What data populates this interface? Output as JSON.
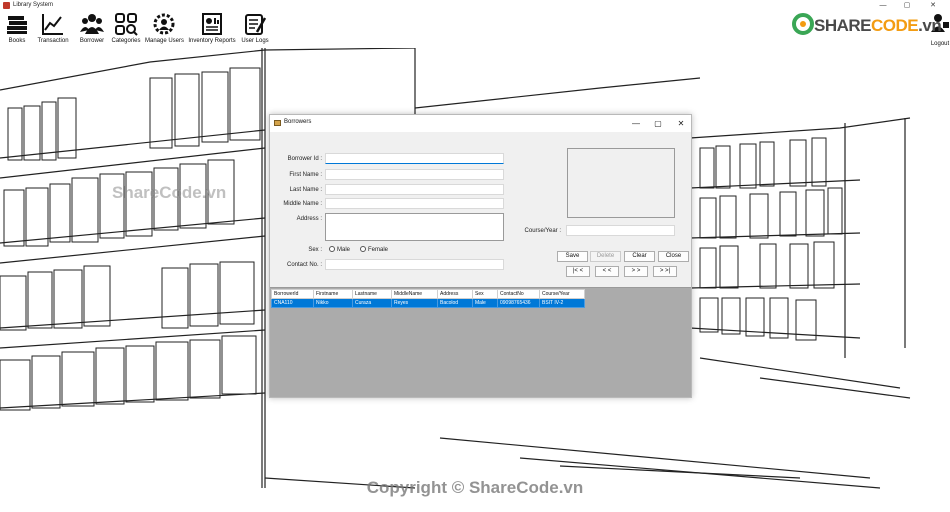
{
  "window": {
    "title": "Library System",
    "controls": {
      "minimize": "—",
      "maximize": "▢",
      "close": "✕"
    }
  },
  "toolbar": {
    "items": [
      {
        "label": "Books",
        "icon": "books-icon"
      },
      {
        "label": "Transaction",
        "icon": "chart-line-icon"
      },
      {
        "label": "Borrower",
        "icon": "users-group-icon"
      },
      {
        "label": "Categories",
        "icon": "categories-grid-icon"
      },
      {
        "label": "Manage Users",
        "icon": "gear-user-icon"
      },
      {
        "label": "Inventory Reports",
        "icon": "report-icon"
      },
      {
        "label": "User Logs",
        "icon": "logs-icon"
      }
    ],
    "logout_label": "Logout"
  },
  "brand": {
    "text_a": "SHARE",
    "text_b": "CODE",
    "text_c": ".vn"
  },
  "watermarks": {
    "middle": "ShareCode.vn",
    "bottom": "Copyright © ShareCode.vn"
  },
  "dialog": {
    "title": "Borrowers",
    "controls": {
      "minimize": "—",
      "maximize": "▢",
      "close": "✕"
    },
    "labels": {
      "borrower_id": "Borrower Id :",
      "first_name": "First Name :",
      "last_name": "Last Name :",
      "middle_name": "Middle Name :",
      "address": "Address :",
      "sex": "Sex :",
      "contact_no": "Contact No. :",
      "course_year": "Course/Year :"
    },
    "values": {
      "borrower_id": "",
      "first_name": "",
      "last_name": "",
      "middle_name": "",
      "contact_no": "",
      "course_year": ""
    },
    "sex_options": [
      "Male",
      "Female"
    ],
    "buttons": {
      "save": "Save",
      "delete": "Delete",
      "clear": "Clear",
      "close": "Close",
      "first": "|< <",
      "prev": "< <",
      "next": "> >",
      "last": "> >|"
    },
    "table": {
      "columns": [
        "BorrowerId",
        "Firstname",
        "Lastname",
        "MiddleName",
        "Address",
        "Sex",
        "ContactNo",
        "Course/Year"
      ],
      "rows": [
        [
          "CNA110",
          "Nikko",
          "Curaza",
          "Reyes",
          "Bacolod",
          "Male",
          "09098765436",
          "BSIT IV-2"
        ]
      ]
    }
  }
}
